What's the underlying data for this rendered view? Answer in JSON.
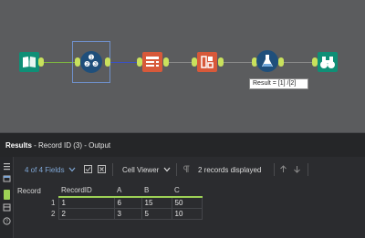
{
  "tooltip": {
    "text": "Result = [1] /[2]"
  },
  "results": {
    "title_bold": "Results",
    "title_rest": " - Record ID (3) - Output"
  },
  "toolbar": {
    "fields_label": "4 of 4 Fields",
    "viewer_label": "Cell Viewer",
    "records_label": "2 records displayed"
  },
  "table": {
    "headers": [
      "Record",
      "RecordID",
      "A",
      "B",
      "C"
    ],
    "rows": [
      {
        "record": "1",
        "recordid": "1",
        "a": "6",
        "b": "15",
        "c": "50"
      },
      {
        "record": "2",
        "recordid": "2",
        "a": "3",
        "b": "5",
        "c": "10"
      }
    ]
  },
  "tools": [
    {
      "name": "input-data-tool",
      "color": "#0f8f76"
    },
    {
      "name": "record-id-tool",
      "color": "#1f4f7b"
    },
    {
      "name": "select-tool",
      "color": "#d7593a"
    },
    {
      "name": "text-to-columns-tool",
      "color": "#d7593a"
    },
    {
      "name": "formula-tool",
      "color": "#1f4f7b"
    },
    {
      "name": "browse-tool",
      "color": "#0f8f76"
    }
  ],
  "colors": {
    "anchor": "#c9e15d",
    "accent_green": "#9dd155",
    "selection": "#6f8fc9"
  }
}
